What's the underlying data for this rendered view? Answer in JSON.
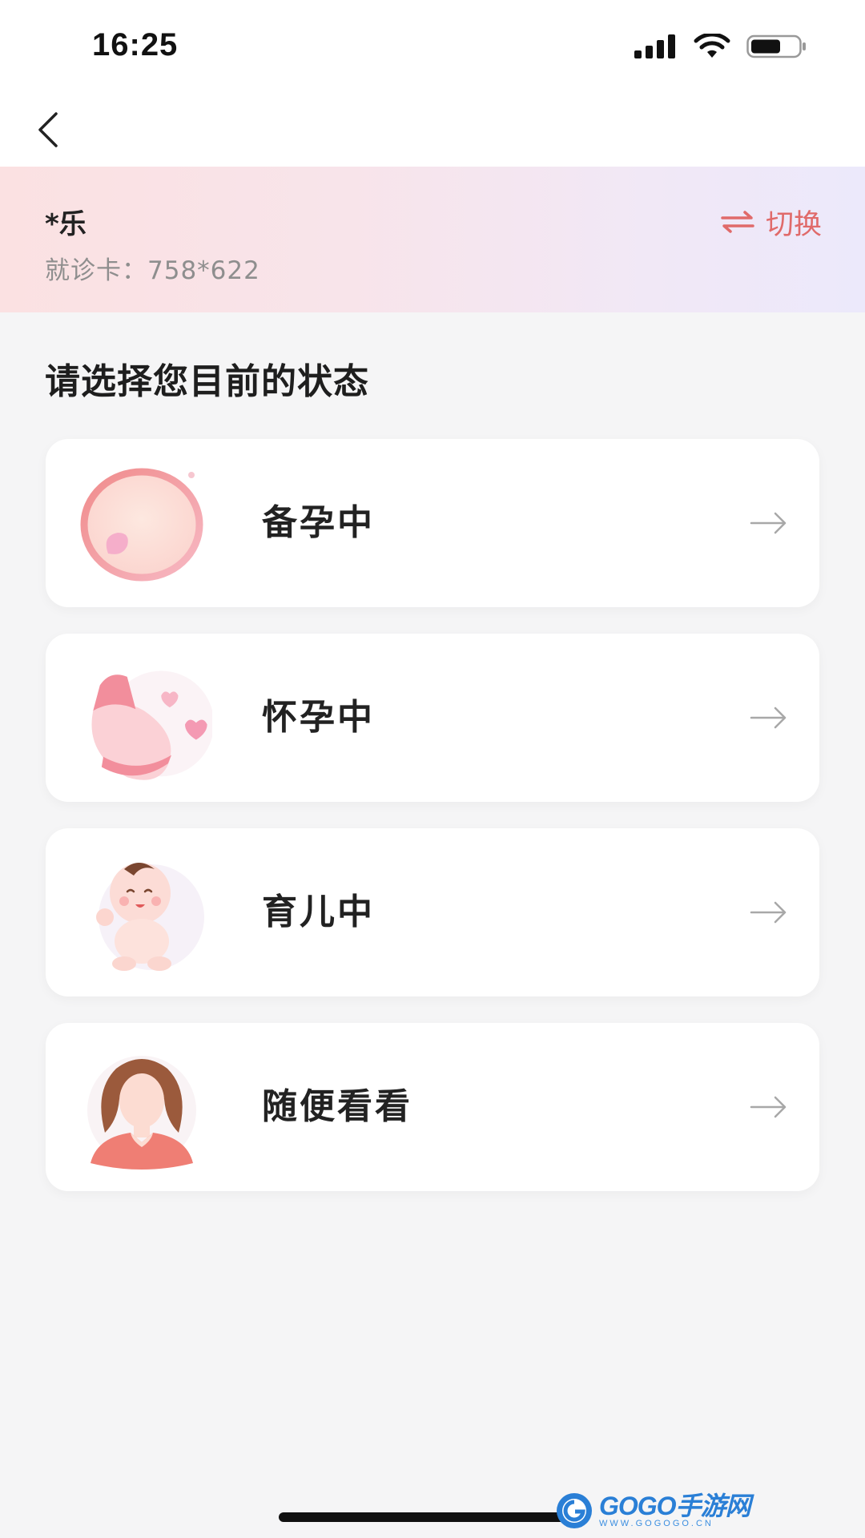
{
  "status_bar": {
    "time": "16:25"
  },
  "patient": {
    "name": "*乐",
    "card_label": "就诊卡：",
    "card_number": "758*622",
    "switch_label": "切换"
  },
  "section_title": "请选择您目前的状态",
  "statuses": [
    {
      "label": "备孕中",
      "icon": "preparing-pregnancy-illustration"
    },
    {
      "label": "怀孕中",
      "icon": "pregnant-illustration"
    },
    {
      "label": "育儿中",
      "icon": "baby-illustration"
    },
    {
      "label": "随便看看",
      "icon": "woman-avatar-illustration"
    }
  ],
  "watermark": {
    "brand": "GOGO手游网",
    "domain": "WWW.GOGOGO.CN"
  },
  "colors": {
    "accent": "#e06a6a",
    "banner_start": "#fbe1e2",
    "banner_end": "#ece9fb",
    "background": "#f5f5f6"
  }
}
